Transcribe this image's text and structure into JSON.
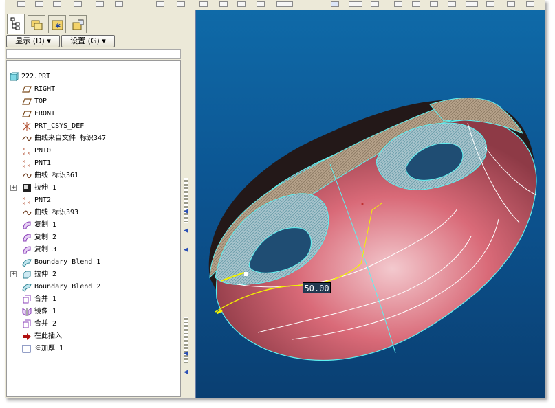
{
  "panel": {
    "show_button": "显示 (D) ▾",
    "settings_button": "设置 (G) ▾"
  },
  "model_tree": {
    "items": [
      {
        "label": "222.PRT",
        "icon": "part-icon"
      },
      {
        "label": "RIGHT",
        "icon": "datum-plane-icon"
      },
      {
        "label": "TOP",
        "icon": "datum-plane-icon"
      },
      {
        "label": "FRONT",
        "icon": "datum-plane-icon"
      },
      {
        "label": "PRT_CSYS_DEF",
        "icon": "csys-icon"
      },
      {
        "label": "曲线来自文件 标识347",
        "icon": "curve-icon"
      },
      {
        "label": "PNT0",
        "icon": "datum-point-icon"
      },
      {
        "label": "PNT1",
        "icon": "datum-point-icon"
      },
      {
        "label": "曲线 标识361",
        "icon": "curve-icon"
      },
      {
        "label": "拉伸 1",
        "icon": "extrude-icon",
        "expandable": true
      },
      {
        "label": "PNT2",
        "icon": "datum-point-icon"
      },
      {
        "label": "曲线 标识393",
        "icon": "curve-icon"
      },
      {
        "label": "复制 1",
        "icon": "copy-surface-icon"
      },
      {
        "label": "复制 2",
        "icon": "copy-surface-icon"
      },
      {
        "label": "复制 3",
        "icon": "copy-surface-icon"
      },
      {
        "label": "Boundary Blend 1",
        "icon": "boundary-blend-icon"
      },
      {
        "label": "拉伸 2",
        "icon": "extrude-surface-icon",
        "expandable": true
      },
      {
        "label": "Boundary Blend 2",
        "icon": "boundary-blend-icon"
      },
      {
        "label": "合并 1",
        "icon": "merge-icon"
      },
      {
        "label": "镜像 1",
        "icon": "mirror-icon"
      },
      {
        "label": "合并 2",
        "icon": "merge-icon"
      },
      {
        "label": "在此插入",
        "icon": "insert-here-arrow-icon"
      },
      {
        "label": "※加厚 1",
        "icon": "thicken-icon"
      }
    ]
  },
  "viewport": {
    "dimension_label": "50.00"
  },
  "colors": {
    "viewport_bg": "#0c5592",
    "surface_pink": "#d96a78",
    "edge_cyan": "#5ef0f0",
    "curve_yellow": "#f2f200"
  }
}
